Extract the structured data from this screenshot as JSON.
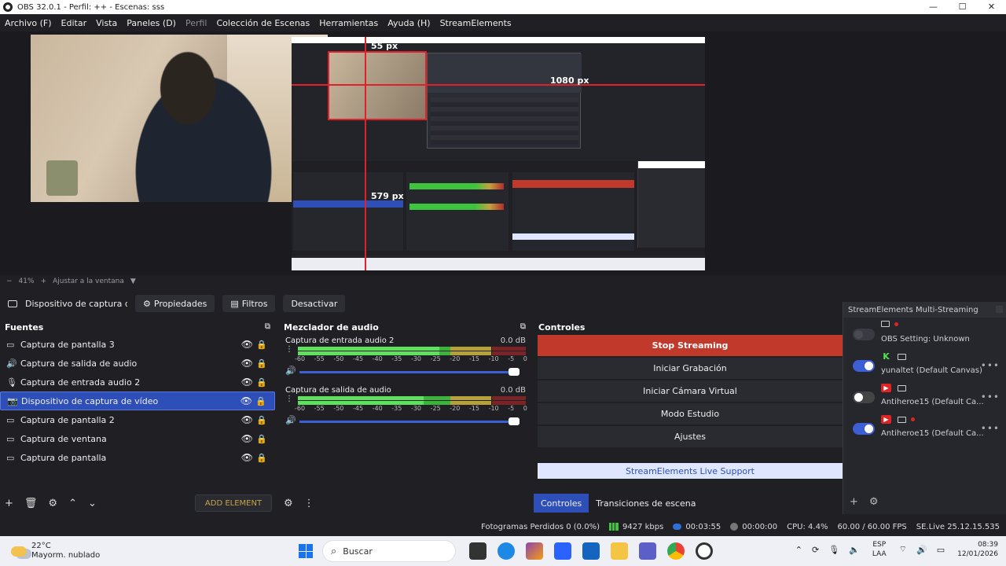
{
  "window": {
    "title": "OBS 32.0.1 - Perfil: ++ - Escenas: sss",
    "minimize": "—",
    "maximize": "☐",
    "close": "✕"
  },
  "menu": {
    "items": [
      "Archivo (F)",
      "Editar",
      "Vista",
      "Paneles (D)",
      "Perfil",
      "Colección de Escenas",
      "Herramientas",
      "Ayuda (H)",
      "StreamElements"
    ]
  },
  "preview": {
    "label_top": "55 px",
    "label_right": "1080 px",
    "label_left": "579 px"
  },
  "zoom": {
    "minus": "−",
    "level": "41%",
    "plus": "+",
    "fit": "Ajustar a la ventana",
    "caret": "▼"
  },
  "source_toolbar": {
    "name": "Dispositivo de captura de v",
    "properties": "Propiedades",
    "filters": "Filtros",
    "deactivate": "Desactivar"
  },
  "sources": {
    "title": "Fuentes",
    "add_element": "ADD ELEMENT",
    "items": [
      {
        "label": "Captura de pantalla 3",
        "icon": "▭",
        "selected": false
      },
      {
        "label": "Captura de salida de audio",
        "icon": "🔊",
        "selected": false
      },
      {
        "label": "Captura de entrada audio 2",
        "icon": "🎙",
        "selected": false
      },
      {
        "label": "Dispositivo de captura de vídeo",
        "icon": "📷",
        "selected": true
      },
      {
        "label": "Captura de pantalla 2",
        "icon": "▭",
        "selected": false
      },
      {
        "label": "Captura de ventana",
        "icon": "▭",
        "selected": false
      },
      {
        "label": "Captura de pantalla",
        "icon": "▭",
        "selected": false
      }
    ]
  },
  "mixer": {
    "title": "Mezclador de audio",
    "ticks": [
      "-60",
      "-55",
      "-50",
      "-45",
      "-40",
      "-35",
      "-30",
      "-25",
      "-20",
      "-15",
      "-10",
      "-5",
      "0"
    ],
    "channels": [
      {
        "name": "Captura de entrada audio 2",
        "db": "0.0 dB",
        "level": 0.62
      },
      {
        "name": "Captura de salida de audio",
        "db": "0.0 dB",
        "level": 0.55
      }
    ]
  },
  "controls": {
    "title": "Controles",
    "stop_streaming": "Stop Streaming",
    "start_recording": "Iniciar Grabación",
    "start_virtual_cam": "Iniciar Cámara Virtual",
    "studio_mode": "Modo Estudio",
    "settings": "Ajustes",
    "live_support": "StreamElements Live Support"
  },
  "tabs": {
    "controls": "Controles",
    "transitions": "Transiciones de escena"
  },
  "multistream": {
    "title": "StreamElements Multi-Streaming",
    "rows": [
      {
        "label": "OBS Setting: Unknown",
        "toggle": "disabled",
        "platform": "",
        "more": ""
      },
      {
        "label": "yunaltet (Default Canvas)",
        "toggle": "on",
        "platform": "K",
        "more": "•••"
      },
      {
        "label": "Antiheroe15 (Default Ca...",
        "toggle": "off",
        "platform": "▶",
        "more": "•••"
      },
      {
        "label": "Antiheroe15 (Default Ca...",
        "toggle": "on",
        "platform": "▶",
        "more": "•••"
      }
    ],
    "add": "+",
    "gear": "⚙"
  },
  "status": {
    "dropped": "Fotogramas Perdidos 0 (0.0%)",
    "kbps": "9427 kbps",
    "live_time": "00:03:55",
    "rec_time": "00:00:00",
    "cpu": "CPU: 4.4%",
    "fps": "60.00 / 60.00 FPS",
    "se_version": "SE.Live 25.12.15.535"
  },
  "taskbar": {
    "temp": "22°C",
    "weather": "Mayorm. nublado",
    "search": "Buscar",
    "lang_top": "ESP",
    "lang_bottom": "LAA",
    "time": "08:39",
    "date": "12/01/2026"
  },
  "colors": {
    "accent": "#2f4fb8",
    "stop": "#c0392b",
    "live_red": "#e0202a"
  }
}
